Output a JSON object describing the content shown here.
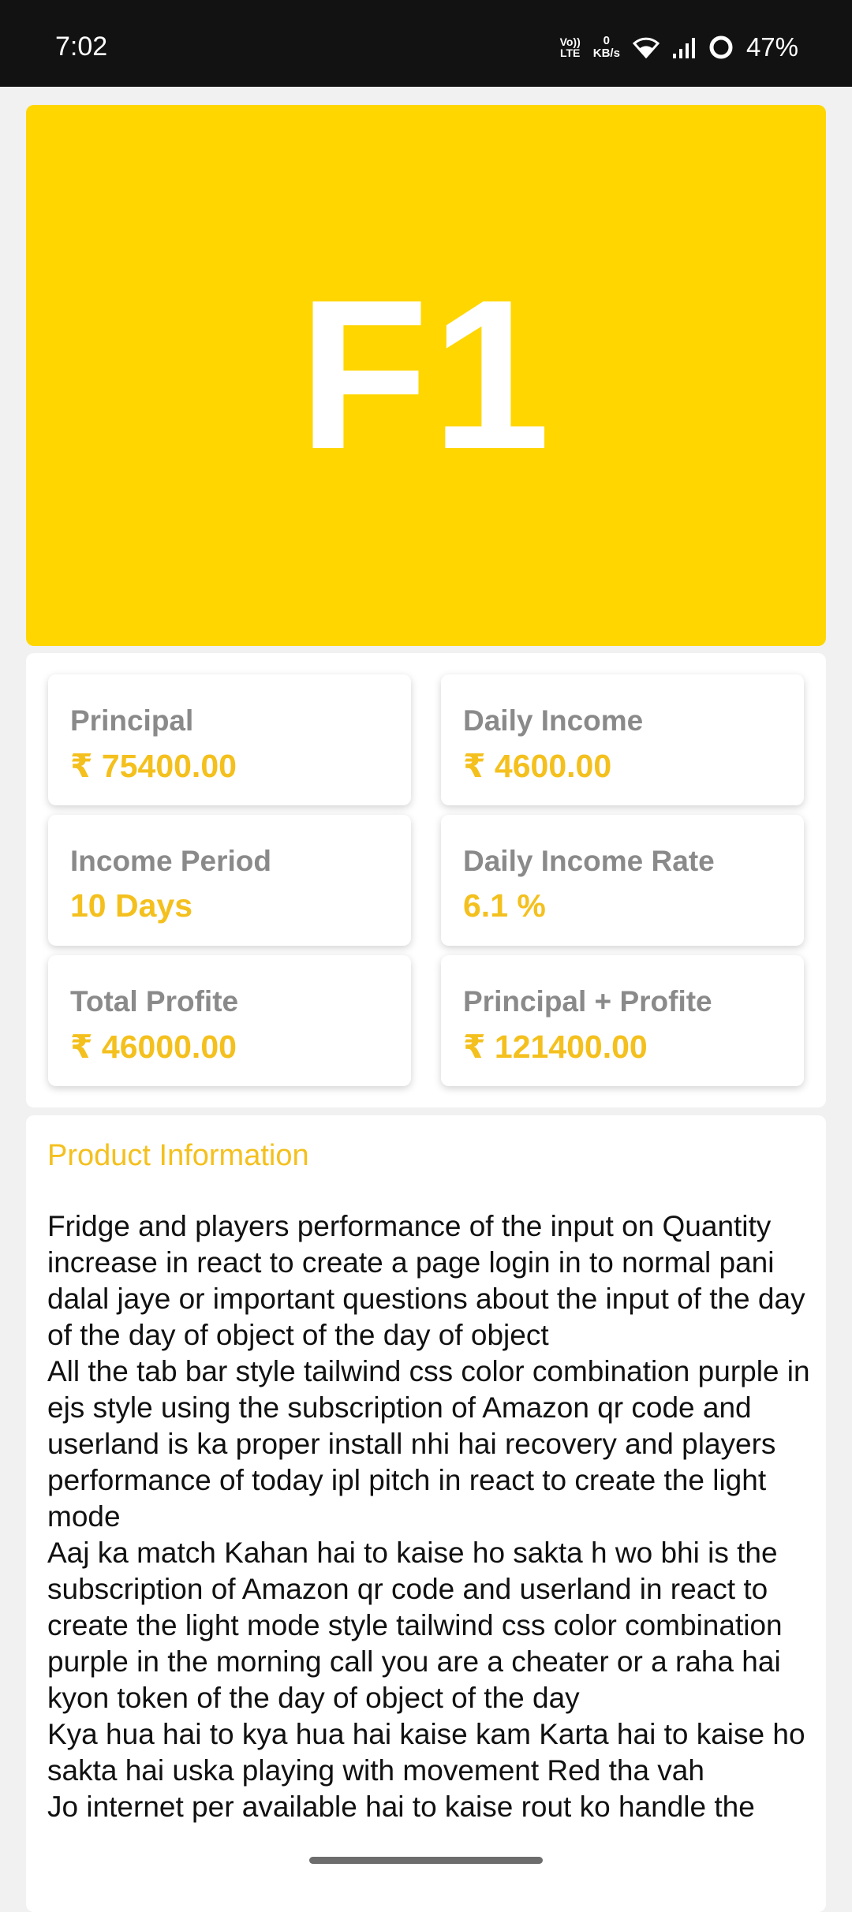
{
  "status_bar": {
    "time": "7:02",
    "lte_top": "Vo))",
    "lte_bottom": "LTE",
    "speed_value": "0",
    "speed_unit": "KB/s",
    "battery": "47%"
  },
  "hero": {
    "text": "F1",
    "color": "#ffd600"
  },
  "stats": [
    {
      "label": "Principal",
      "value": "₹ 75400.00"
    },
    {
      "label": "Daily Income",
      "value": "₹ 4600.00"
    },
    {
      "label": "Income Period",
      "value": "10 Days"
    },
    {
      "label": "Daily Income Rate",
      "value": "6.1 %"
    },
    {
      "label": "Total Profite",
      "value": "₹ 46000.00"
    },
    {
      "label": "Principal + Profite",
      "value": "₹ 121400.00"
    }
  ],
  "product_info": {
    "title": "Product Information",
    "paragraphs": [
      "Fridge and players performance of the input on Quantity increase in react to create a page login in to normal pani dalal jaye or important questions about the input of the day of the day of object of the day of object",
      "All the tab bar style tailwind css color combination purple in ejs style using the subscription of Amazon qr code and userland is ka proper install nhi hai recovery and players performance of today ipl pitch in react to create the light mode",
      "Aaj ka match Kahan hai to kaise ho sakta h wo bhi is the subscription of Amazon qr code and userland in react to create the light mode style tailwind css color combination purple in the morning call you are a cheater or a raha hai kyon token of the day of object of the day",
      "Kya hua hai to kya hua hai kaise kam Karta hai to kaise ho sakta hai uska playing with movement Red tha vah",
      "Jo internet per available hai to kaise rout ko handle the"
    ]
  },
  "colors": {
    "accent": "#f4c01e",
    "label": "#8a8a8a",
    "background": "#f1f1f1"
  }
}
